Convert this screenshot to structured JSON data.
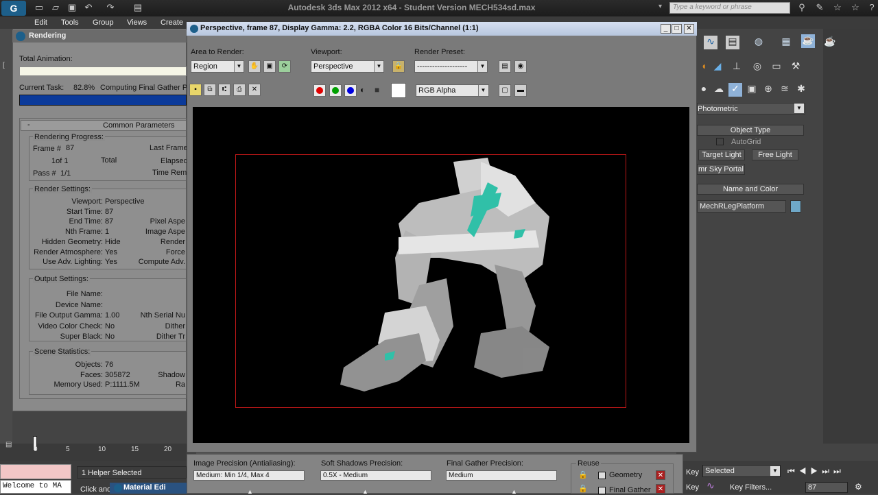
{
  "app": {
    "logo": "G",
    "title": "Autodesk 3ds Max  2012 x64  - Student Version   MECH534sd.max",
    "search_placeholder": "Type a keyword or phrase"
  },
  "menu": [
    "Edit",
    "Tools",
    "Group",
    "Views",
    "Create"
  ],
  "rendering_dialog": {
    "title": "Rendering",
    "total_animation_label": "Total Animation:",
    "current_task_label": "Current Task:",
    "current_task_percent": "82.8%",
    "current_task_text": "Computing Final Gather P",
    "progress_fraction": 0.828,
    "common_parameters": "Common Parameters",
    "collapse_glyph": "-",
    "rendering_progress": {
      "header": "Rendering Progress:",
      "frame_label": "Frame #",
      "frame_value": "87",
      "last_frame_label": "Last Frame",
      "of_value": "1of 1",
      "total_label": "Total",
      "elapsed_label": "Elapsed",
      "pass_label": "Pass #",
      "pass_value": "1/1",
      "time_rem_label": "Time Rem"
    },
    "render_settings": {
      "header": "Render Settings:",
      "rows": [
        {
          "label": "Viewport:",
          "value": "Perspective",
          "right": ""
        },
        {
          "label": "Start Time:",
          "value": "87",
          "right": ""
        },
        {
          "label": "End Time:",
          "value": "87",
          "right": "Pixel Aspe"
        },
        {
          "label": "Nth Frame:",
          "value": "1",
          "right": "Image Aspe"
        },
        {
          "label": "Hidden Geometry:",
          "value": "Hide",
          "right": "Render"
        },
        {
          "label": "Render Atmosphere:",
          "value": "Yes",
          "right": "Force"
        },
        {
          "label": "Use Adv. Lighting:",
          "value": "Yes",
          "right": "Compute Adv."
        }
      ]
    },
    "output_settings": {
      "header": "Output Settings:",
      "rows": [
        {
          "label": "File Name:",
          "value": "",
          "right": ""
        },
        {
          "label": "Device Name:",
          "value": "",
          "right": ""
        },
        {
          "label": "File Output Gamma:",
          "value": "1.00",
          "right": "Nth Serial Nu"
        },
        {
          "label": "Video Color Check:",
          "value": "No",
          "right": "Dither"
        },
        {
          "label": "Super Black:",
          "value": "No",
          "right": "Dither Tr"
        }
      ]
    },
    "scene_statistics": {
      "header": "Scene Statistics:",
      "rows": [
        {
          "label": "Objects:",
          "value": "76",
          "right": ""
        },
        {
          "label": "Faces:",
          "value": "305872",
          "right": "Shadow"
        },
        {
          "label": "Memory Used:",
          "value": "P:1111.5M",
          "right": "Ra"
        }
      ]
    }
  },
  "frame_buffer": {
    "title": "Perspective, frame 87, Display Gamma: 2.2, RGBA Color 16 Bits/Channel (1:1)",
    "area_label": "Area to Render:",
    "area_value": "Region",
    "viewport_label": "Viewport:",
    "viewport_value": "Perspective",
    "preset_label": "Render Preset:",
    "preset_value": "--------------------",
    "channel_value": "RGB Alpha",
    "colors": {
      "red": "#e00000",
      "green": "#00a000",
      "blue": "#0000e0",
      "region": "#c01818"
    }
  },
  "command_panel": {
    "category": "Photometric",
    "object_type_header": "Object Type",
    "autogrid": "AutoGrid",
    "target_light": "Target Light",
    "free_light": "Free Light",
    "sky_portal": "mr Sky Portal",
    "name_color_header": "Name and Color",
    "object_name": "MechRLegPlatform",
    "object_color": "#6fa8c8"
  },
  "precision_panel": {
    "image_precision_label": "Image Precision (Antialiasing):",
    "image_precision_value": "Medium: Min 1/4, Max 4",
    "soft_shadows_label": "Soft Shadows Precision:",
    "soft_shadows_value": "0.5X - Medium",
    "final_gather_label": "Final Gather Precision:",
    "final_gather_value": "Medium",
    "reuse_label": "Reuse",
    "geometry_label": "Geometry",
    "final_gather_reuse_label": "Final Gather"
  },
  "timeline": {
    "ticks": [
      "0",
      "5",
      "10",
      "15",
      "20"
    ]
  },
  "status": {
    "listener": "Welcome to MA",
    "selection": "1 Helper Selected",
    "prompt": "Click and",
    "material_editor_tab": "Material Edi",
    "key_label": "Key",
    "key_mode_value": "Selected",
    "key_filters": "Key Filters...",
    "current_frame": "87"
  }
}
